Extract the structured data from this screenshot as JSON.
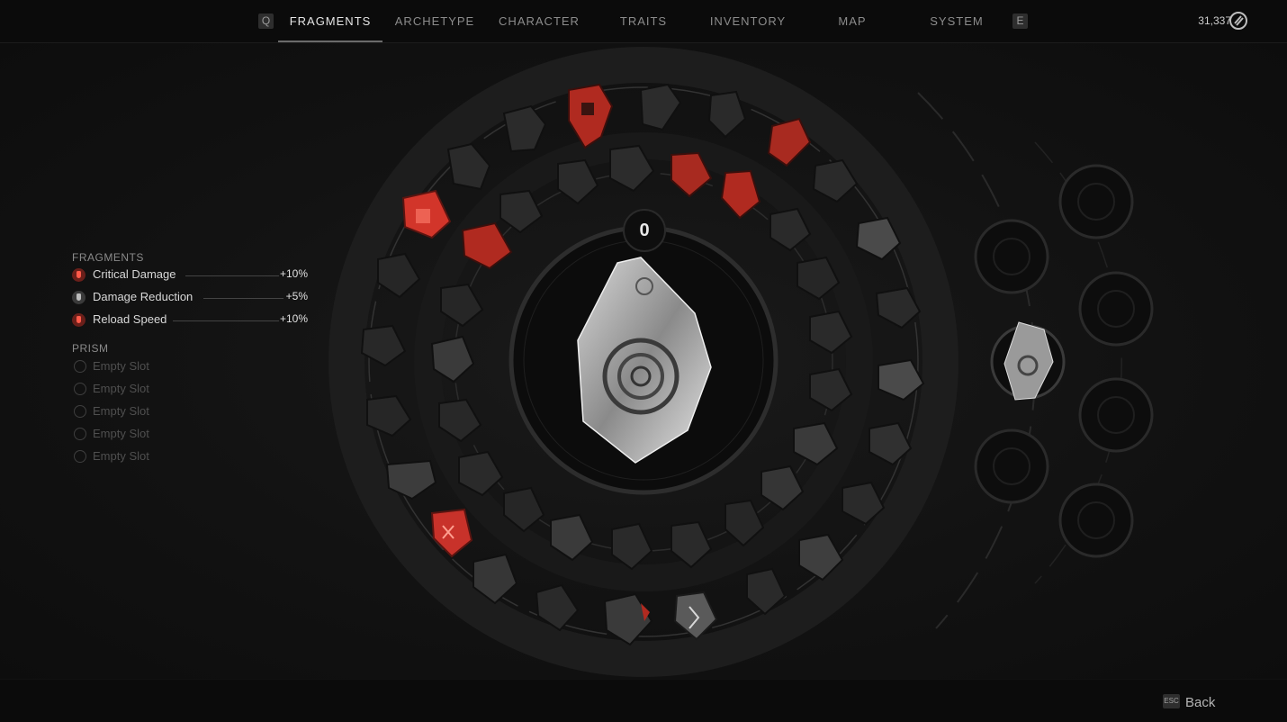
{
  "nav": {
    "left_key": "Q",
    "right_key": "E",
    "tabs": [
      "FRAGMENTS",
      "ARCHETYPE",
      "CHARACTER",
      "TRAITS",
      "INVENTORY",
      "MAP",
      "SYSTEM"
    ],
    "active_tab": "FRAGMENTS"
  },
  "currency": {
    "amount": "31,337",
    "icon": "scrap-icon"
  },
  "fragments_panel": {
    "title": "FRAGMENTS",
    "stats": [
      {
        "name": "Critical Damage",
        "value": "+10%",
        "icon_color": "#ff5a4a"
      },
      {
        "name": "Damage Reduction",
        "value": "+5%",
        "icon_color": "#bdbdbd"
      },
      {
        "name": "Reload Speed",
        "value": "+10%",
        "icon_color": "#ff5a4a"
      }
    ]
  },
  "prism_panel": {
    "title": "PRISM",
    "slots": [
      "Empty Slot",
      "Empty Slot",
      "Empty Slot",
      "Empty Slot",
      "Empty Slot"
    ]
  },
  "center": {
    "counter": "0"
  },
  "footer": {
    "esc_key": "ESC",
    "back_label": "Back"
  },
  "colors": {
    "accent_red": "#e0392b",
    "fragment_gray": "#3a3a3a"
  }
}
